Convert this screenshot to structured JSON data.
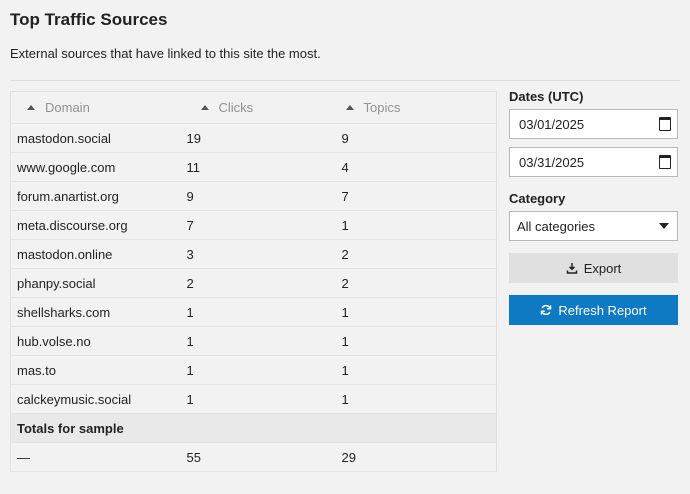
{
  "header": {
    "title": "Top Traffic Sources",
    "description": "External sources that have linked to this site the most."
  },
  "table": {
    "columns": [
      "Domain",
      "Clicks",
      "Topics"
    ],
    "rows": [
      [
        "mastodon.social",
        "19",
        "9"
      ],
      [
        "www.google.com",
        "11",
        "4"
      ],
      [
        "forum.anartist.org",
        "9",
        "7"
      ],
      [
        "meta.discourse.org",
        "7",
        "1"
      ],
      [
        "mastodon.online",
        "3",
        "2"
      ],
      [
        "phanpy.social",
        "2",
        "2"
      ],
      [
        "shellsharks.com",
        "1",
        "1"
      ],
      [
        "hub.volse.no",
        "1",
        "1"
      ],
      [
        "mas.to",
        "1",
        "1"
      ],
      [
        "calckeymusic.social",
        "1",
        "1"
      ]
    ],
    "totals_label": "Totals for sample",
    "totals": [
      "—",
      "55",
      "29"
    ]
  },
  "filters": {
    "dates_label": "Dates (UTC)",
    "start_date": "03/01/2025",
    "end_date": "03/31/2025",
    "category_label": "Category",
    "category_value": "All categories"
  },
  "actions": {
    "export_label": "Export",
    "refresh_label": "Refresh Report"
  },
  "colors": {
    "primary": "#0e7ac4",
    "background": "#f2f2f2"
  }
}
